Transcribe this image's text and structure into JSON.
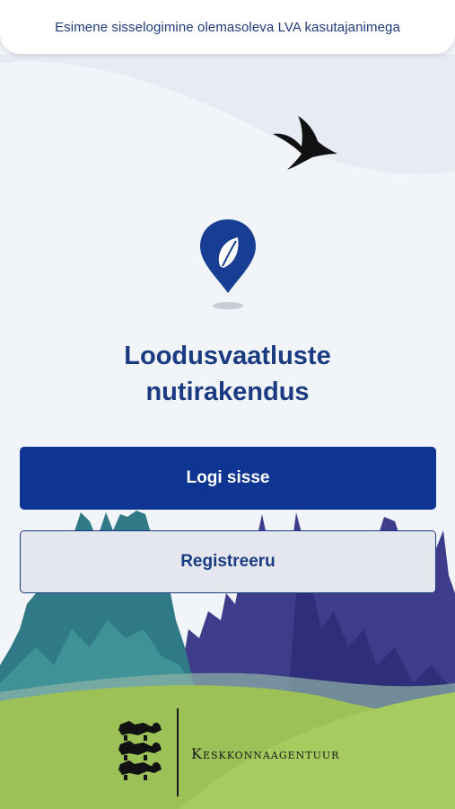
{
  "banner": {
    "text": "Esimene sisselogimine olemasoleva LVA kasutajanimega"
  },
  "app": {
    "title_line1": "Loodusvaatluste",
    "title_line2": "nutirakendus"
  },
  "actions": {
    "login_label": "Logi sisse",
    "register_label": "Registreeru"
  },
  "footer": {
    "agency_name": "Keskkonnaagentuur"
  },
  "colors": {
    "primary": "#0d3591",
    "title": "#1a3a82",
    "background": "#f1f4f9",
    "grass": "#9cc257",
    "forest_teal": "#2f7a86",
    "forest_purple": "#3e3d8c"
  }
}
